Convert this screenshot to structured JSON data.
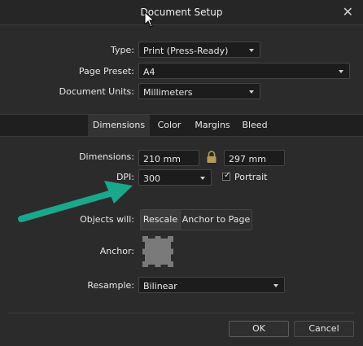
{
  "window": {
    "title": "Document Setup",
    "close_glyph": "✕"
  },
  "top_settings": {
    "type": {
      "label": "Type:",
      "value": "Print (Press-Ready)"
    },
    "page_preset": {
      "label": "Page Preset:",
      "value": "A4"
    },
    "document_units": {
      "label": "Document Units:",
      "value": "Millimeters"
    }
  },
  "tabs": [
    {
      "label": "Dimensions",
      "active": true
    },
    {
      "label": "Color",
      "active": false
    },
    {
      "label": "Margins",
      "active": false
    },
    {
      "label": "Bleed",
      "active": false
    }
  ],
  "dimensions": {
    "label": "Dimensions:",
    "width": "210 mm",
    "height": "297 mm",
    "lock_icon": "padlock-icon"
  },
  "dpi": {
    "label": "DPI:",
    "value": "300",
    "portrait_label": "Portrait",
    "portrait_checked": true,
    "checkmark_glyph": "✓"
  },
  "objects_will": {
    "label": "Objects will:",
    "options": [
      "Rescale",
      "Anchor to Page"
    ],
    "selected": "Rescale"
  },
  "anchor": {
    "label": "Anchor:"
  },
  "resample": {
    "label": "Resample:",
    "value": "Bilinear"
  },
  "buttons": {
    "ok": "OK",
    "cancel": "Cancel"
  },
  "colors": {
    "arrow": "#1aa88c",
    "background": "#2b2b2b",
    "tab_bar": "#1f1f1f"
  }
}
